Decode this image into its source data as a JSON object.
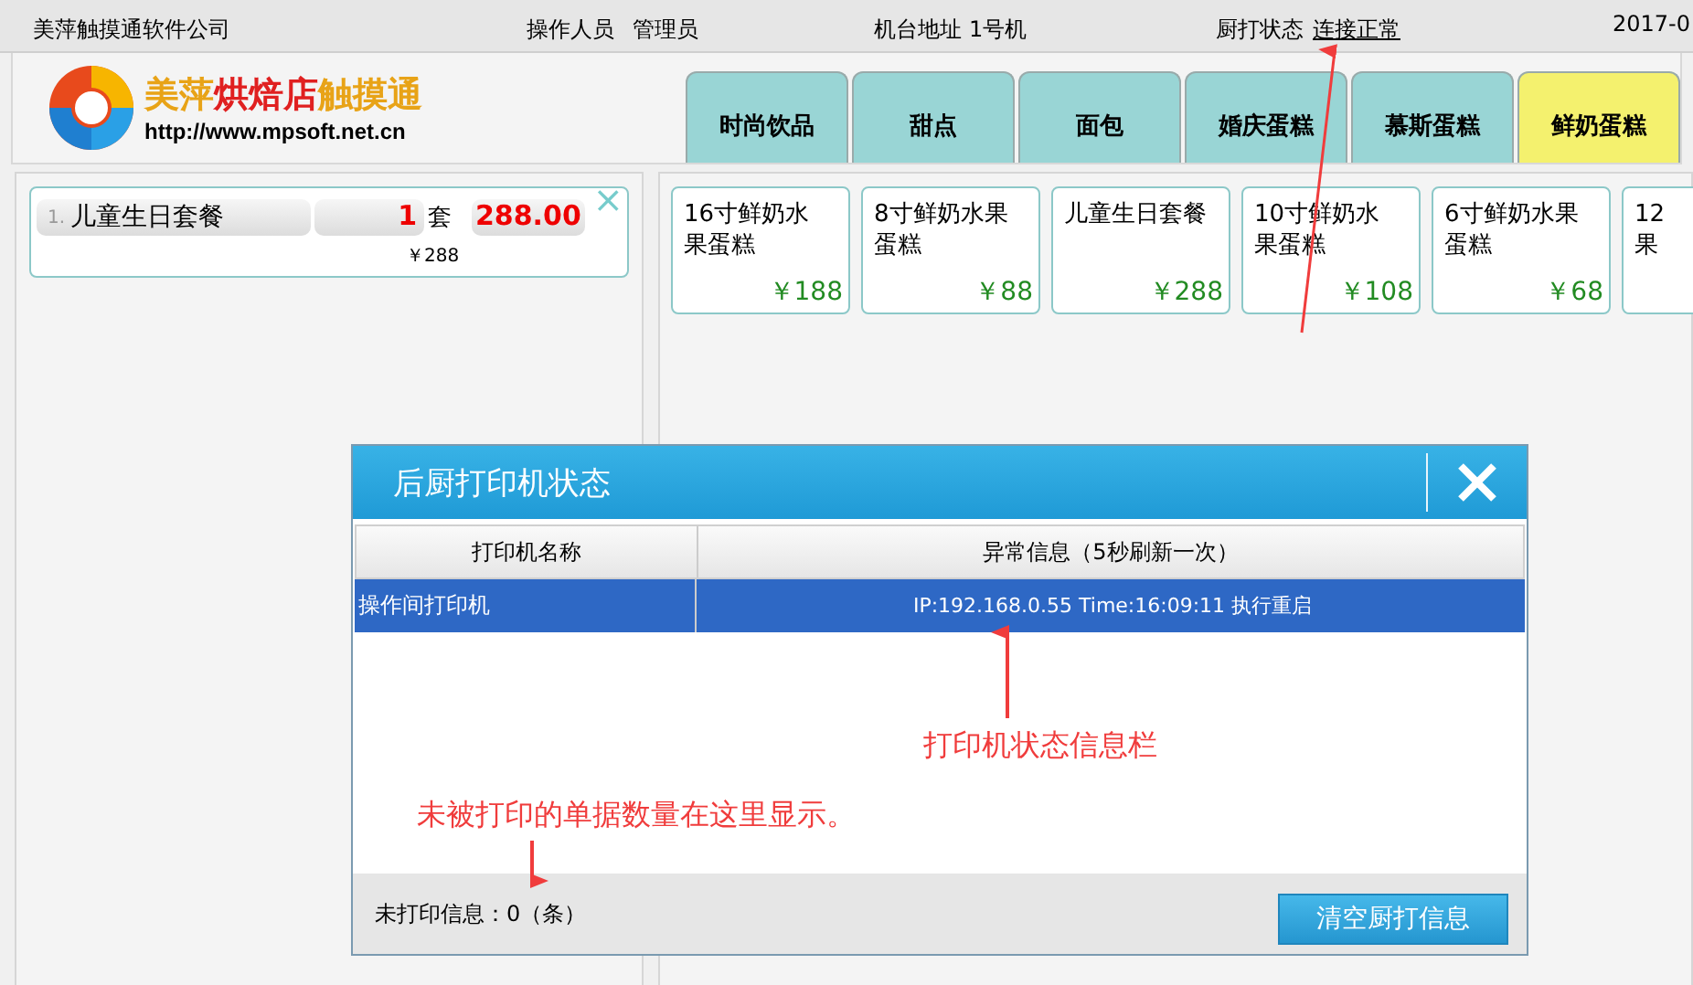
{
  "top_bar": {
    "company": "美萍触摸通软件公司",
    "operator_label": "操作人员",
    "operator": "管理员",
    "terminal_label": "机台地址",
    "terminal": "1号机",
    "kitchen_label": "厨打状态",
    "kitchen_status": "连接正常",
    "date": "2017-0"
  },
  "logo": {
    "parts": [
      {
        "text": "美萍",
        "color": "#e8a317"
      },
      {
        "text": "烘焙店",
        "color": "#e02020"
      },
      {
        "text": "触摸通",
        "color": "#e8a317"
      }
    ],
    "url": "http://www.mpsoft.net.cn"
  },
  "tabs": [
    {
      "label": "时尚饮品",
      "selected": false
    },
    {
      "label": "甜点",
      "selected": false
    },
    {
      "label": "面包",
      "selected": false
    },
    {
      "label": "婚庆蛋糕",
      "selected": false
    },
    {
      "label": "慕斯蛋糕",
      "selected": false
    },
    {
      "label": "鲜奶蛋糕",
      "selected": true
    }
  ],
  "order_items": [
    {
      "index": "1.",
      "name": "儿童生日套餐",
      "qty": "1",
      "unit": "套",
      "total": "288.00",
      "price": "￥288",
      "remove": "×"
    }
  ],
  "products": [
    {
      "lines": [
        "16寸鲜奶水",
        "果蛋糕"
      ],
      "price": "￥188"
    },
    {
      "lines": [
        "8寸鲜奶水果",
        "蛋糕"
      ],
      "price": "￥88"
    },
    {
      "lines": [
        "儿童生日套餐"
      ],
      "price": "￥288"
    },
    {
      "lines": [
        "10寸鲜奶水",
        "果蛋糕"
      ],
      "price": "￥108"
    },
    {
      "lines": [
        "6寸鲜奶水果",
        "蛋糕"
      ],
      "price": "￥68"
    },
    {
      "lines": [
        "12",
        "果"
      ]
    }
  ],
  "dialog": {
    "title": "后厨打印机状态",
    "columns": [
      "打印机名称",
      "异常信息（5秒刷新一次）"
    ],
    "rows": [
      {
        "name": "操作间打印机",
        "info": "IP:192.168.0.55 Time:16:09:11 执行重启",
        "selected": true
      }
    ],
    "footer": "未打印信息：0（条）",
    "clear_button": "清空厨打信息"
  },
  "annotations": [
    "打印机状态信息栏",
    "未被打印的单据数量在这里显示。"
  ]
}
